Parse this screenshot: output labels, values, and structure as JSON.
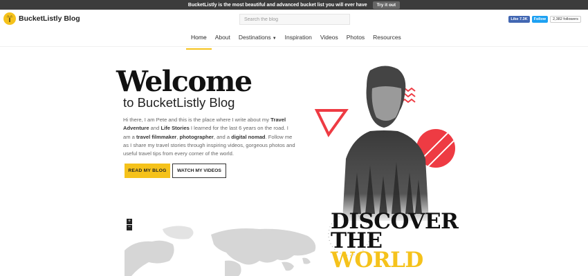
{
  "promo": {
    "text": "BucketListly is the most beautiful and advanced bucket list you will ever have",
    "button": "Try it out"
  },
  "header": {
    "logo_text": "BucketListly Blog",
    "search_placeholder": "Search the blog",
    "facebook_like": "Like 7.3K",
    "twitter_follow": "Follow",
    "twitter_followers": "2,382 followers"
  },
  "nav": {
    "items": [
      {
        "label": "Home",
        "active": true
      },
      {
        "label": "About"
      },
      {
        "label": "Destinations",
        "has_dropdown": true
      },
      {
        "label": "Inspiration"
      },
      {
        "label": "Videos"
      },
      {
        "label": "Photos"
      },
      {
        "label": "Resources"
      }
    ]
  },
  "hero": {
    "title": "Welcome",
    "subtitle": "to BucketListly Blog",
    "intro": {
      "t1": "Hi there, I am Pete and this is the place where I write about my ",
      "b1": "Travel Adventure",
      "t2": " and ",
      "b2": "Life Stories",
      "t3": " I learned for the last 6 years on the road. I am a ",
      "b3": "travel filmmaker",
      "t4": ", ",
      "b4": "photographer",
      "t5": ", and a ",
      "b5": "digital nomad",
      "t6": ". Follow me as I share my travel stories through inspiring videos, gorgeous photos and useful travel tips from every corner of the world."
    },
    "read_button": "READ MY BLOG",
    "watch_button": "WATCH MY VIDEOS",
    "discover_lines": [
      "DISCOVER",
      "THE",
      "WORLD"
    ]
  },
  "map": {
    "zoom_in": "+",
    "zoom_out": "−"
  },
  "colors": {
    "accent": "#f5c21b",
    "shape_red": "#ee3b43",
    "promo_bg": "#3c3c3c",
    "map_land": "#d6d6d6"
  }
}
